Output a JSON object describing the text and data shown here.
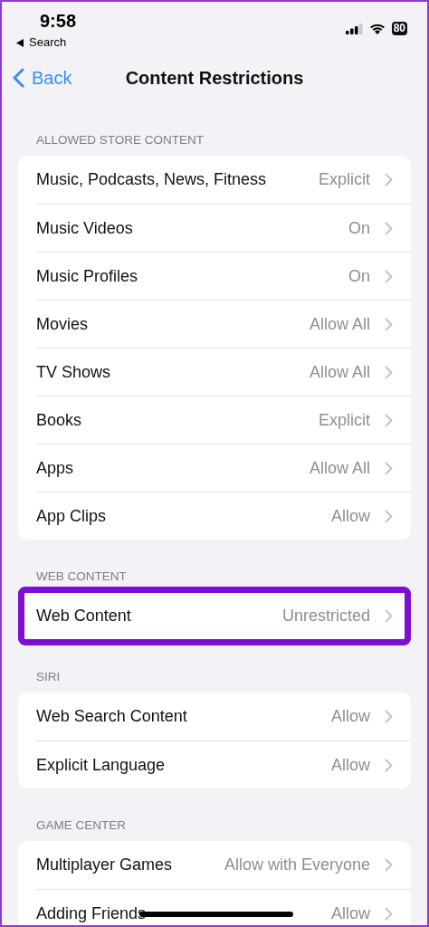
{
  "status_bar": {
    "time": "9:58",
    "back_app": "Search",
    "battery": "80"
  },
  "nav": {
    "back": "Back",
    "title": "Content Restrictions"
  },
  "sections": [
    {
      "header": "ALLOWED STORE CONTENT",
      "highlighted": false,
      "rows": [
        {
          "label": "Music, Podcasts, News, Fitness",
          "value": "Explicit"
        },
        {
          "label": "Music Videos",
          "value": "On"
        },
        {
          "label": "Music Profiles",
          "value": "On"
        },
        {
          "label": "Movies",
          "value": "Allow All"
        },
        {
          "label": "TV Shows",
          "value": "Allow All"
        },
        {
          "label": "Books",
          "value": "Explicit"
        },
        {
          "label": "Apps",
          "value": "Allow All"
        },
        {
          "label": "App Clips",
          "value": "Allow"
        }
      ]
    },
    {
      "header": "WEB CONTENT",
      "highlighted": true,
      "rows": [
        {
          "label": "Web Content",
          "value": "Unrestricted"
        }
      ]
    },
    {
      "header": "SIRI",
      "highlighted": false,
      "rows": [
        {
          "label": "Web Search Content",
          "value": "Allow"
        },
        {
          "label": "Explicit Language",
          "value": "Allow"
        }
      ]
    },
    {
      "header": "GAME CENTER",
      "highlighted": false,
      "rows": [
        {
          "label": "Multiplayer Games",
          "value": "Allow with Everyone"
        },
        {
          "label": "Adding Friends",
          "value": "Allow"
        }
      ]
    }
  ]
}
